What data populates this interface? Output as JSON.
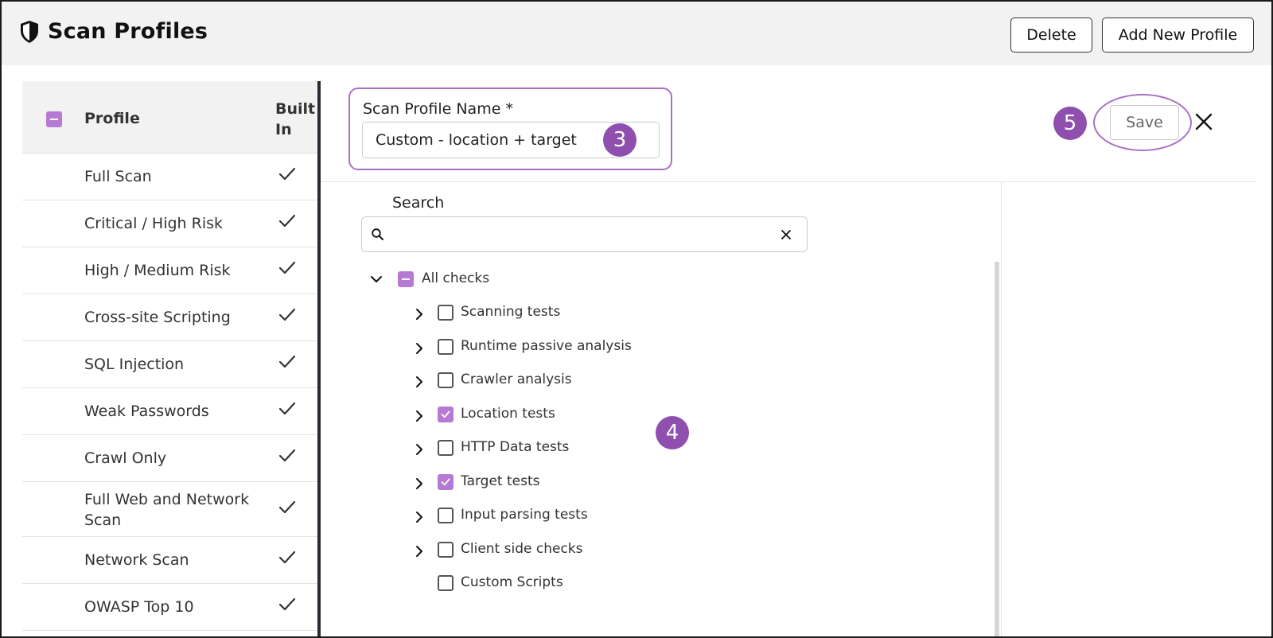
{
  "header": {
    "title": "Scan Profiles",
    "delete_label": "Delete",
    "add_label": "Add New Profile"
  },
  "table": {
    "col_profile": "Profile",
    "col_builtin": "Built In",
    "rows": [
      {
        "name": "Full Scan",
        "built_in": true
      },
      {
        "name": "Critical / High Risk",
        "built_in": true
      },
      {
        "name": "High / Medium Risk",
        "built_in": true
      },
      {
        "name": "Cross-site Scripting",
        "built_in": true
      },
      {
        "name": "SQL Injection",
        "built_in": true
      },
      {
        "name": "Weak Passwords",
        "built_in": true
      },
      {
        "name": "Crawl Only",
        "built_in": true
      },
      {
        "name": "Full Web and Network Scan",
        "built_in": true
      },
      {
        "name": "Network Scan",
        "built_in": true
      },
      {
        "name": "OWASP Top 10",
        "built_in": true
      }
    ]
  },
  "editor": {
    "name_label": "Scan Profile Name *",
    "name_value": "Custom - location + target",
    "save_label": "Save",
    "search_label": "Search",
    "search_value": ""
  },
  "annotations": {
    "step3": "3",
    "step4": "4",
    "step5": "5"
  },
  "tree": {
    "root": {
      "label": "All checks",
      "state": "partial",
      "expanded": true
    },
    "children": [
      {
        "label": "Scanning tests",
        "checked": false,
        "expandable": true
      },
      {
        "label": "Runtime passive analysis",
        "checked": false,
        "expandable": true
      },
      {
        "label": "Crawler analysis",
        "checked": false,
        "expandable": true
      },
      {
        "label": "Location tests",
        "checked": true,
        "expandable": true
      },
      {
        "label": "HTTP Data tests",
        "checked": false,
        "expandable": true
      },
      {
        "label": "Target tests",
        "checked": true,
        "expandable": true
      },
      {
        "label": "Input parsing tests",
        "checked": false,
        "expandable": true
      },
      {
        "label": "Client side checks",
        "checked": false,
        "expandable": true
      },
      {
        "label": "Custom Scripts",
        "checked": false,
        "expandable": false
      }
    ]
  },
  "colors": {
    "accent": "#b77ad4",
    "annotation": "#8e4fae",
    "highlight_ring": "#a970c4"
  }
}
